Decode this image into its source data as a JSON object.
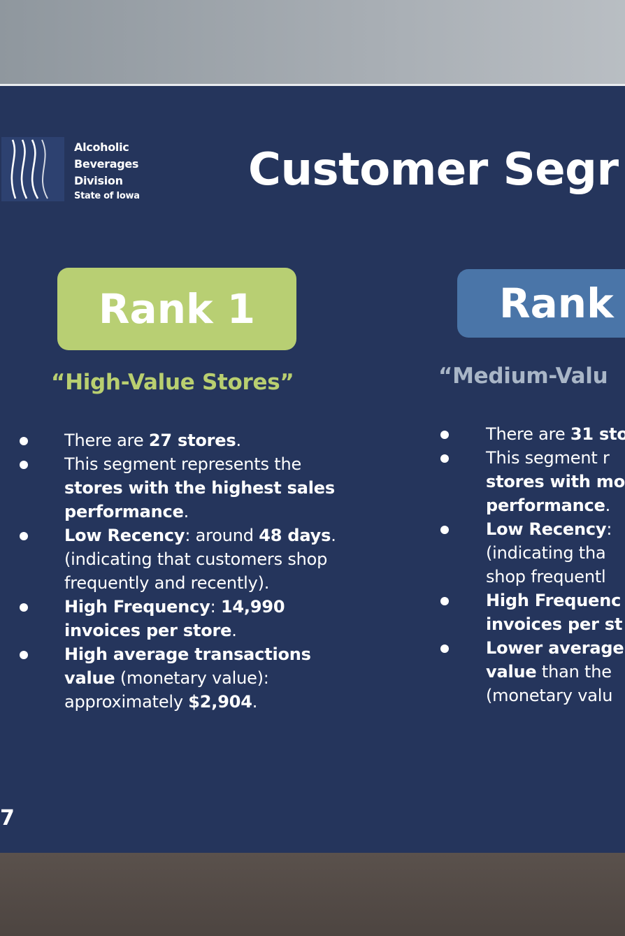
{
  "logo": {
    "line1": "Alcoholic",
    "line2": "Beverages",
    "line3": "Division",
    "line4": "State of Iowa"
  },
  "title": "Customer Segr",
  "segments": [
    {
      "rank": "Rank 1",
      "name": "“High-Value Stores”",
      "color": "#b8cf73",
      "bullets": [
        [
          {
            "t": "There are "
          },
          {
            "t": "27 stores",
            "b": true
          },
          {
            "t": "."
          }
        ],
        [
          {
            "t": "This segment represents the"
          }
        ],
        [
          {
            "t": "stores with the highest sales",
            "b": true
          }
        ],
        [
          {
            "t": "performance",
            "b": true
          },
          {
            "t": "."
          }
        ],
        [
          {
            "t": "Low Recency",
            "b": true
          },
          {
            "t": ": around "
          },
          {
            "t": "48 days",
            "b": true
          },
          {
            "t": "."
          }
        ],
        [
          {
            "t": "(indicating that customers shop"
          }
        ],
        [
          {
            "t": "frequently and recently)."
          }
        ],
        [
          {
            "t": "High Frequency",
            "b": true
          },
          {
            "t": ": "
          },
          {
            "t": "14,990",
            "b": true
          }
        ],
        [
          {
            "t": "invoices per store",
            "b": true
          },
          {
            "t": "."
          }
        ],
        [
          {
            "t": "High average transactions",
            "b": true
          }
        ],
        [
          {
            "t": "value",
            "b": true
          },
          {
            "t": " (monetary value):"
          }
        ],
        [
          {
            "t": "approximately "
          },
          {
            "t": "$2,904",
            "b": true
          },
          {
            "t": "."
          }
        ]
      ],
      "bullet_starts": [
        0,
        1,
        4,
        7,
        9
      ]
    },
    {
      "rank": "Rank",
      "name": "“Medium-Valu",
      "color": "#4a75a8",
      "bullets": [
        [
          {
            "t": "There are "
          },
          {
            "t": "31 sto",
            "b": true
          }
        ],
        [
          {
            "t": "This segment r"
          }
        ],
        [
          {
            "t": "stores with mo",
            "b": true
          }
        ],
        [
          {
            "t": "performance",
            "b": true
          },
          {
            "t": "."
          }
        ],
        [
          {
            "t": "Low Recency",
            "b": true
          },
          {
            "t": ":"
          }
        ],
        [
          {
            "t": "(indicating tha"
          }
        ],
        [
          {
            "t": "shop frequentl"
          }
        ],
        [
          {
            "t": "High Frequenc",
            "b": true
          }
        ],
        [
          {
            "t": "invoices per st",
            "b": true
          }
        ],
        [
          {
            "t": "Lower average",
            "b": true
          }
        ],
        [
          {
            "t": "value",
            "b": true
          },
          {
            "t": " than the"
          }
        ],
        [
          {
            "t": "(monetary valu"
          }
        ]
      ],
      "bullet_starts": [
        0,
        1,
        4,
        7,
        9
      ]
    }
  ],
  "footer_mark": "7"
}
